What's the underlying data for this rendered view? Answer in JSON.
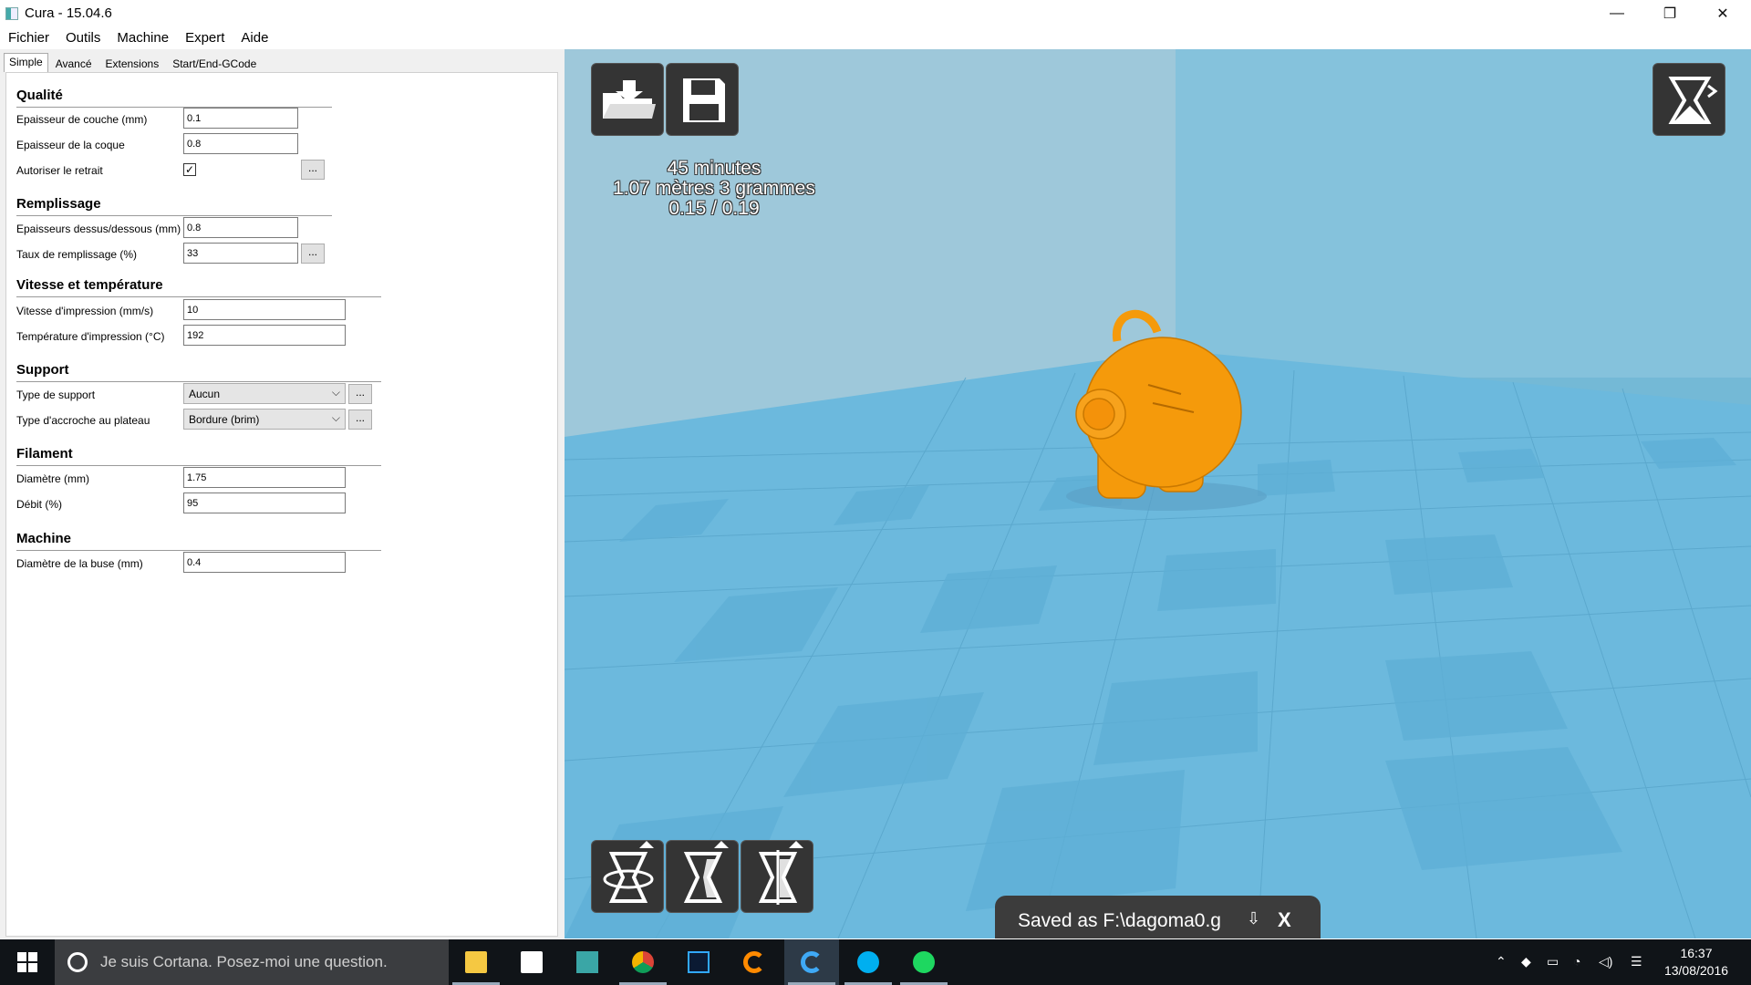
{
  "window": {
    "title": "Cura - 15.04.6",
    "minimize": "—",
    "restore": "❐",
    "close": "✕"
  },
  "menu": [
    "Fichier",
    "Outils",
    "Machine",
    "Expert",
    "Aide"
  ],
  "tabs": [
    "Simple",
    "Avancé",
    "Extensions",
    "Start/End-GCode"
  ],
  "sections": {
    "qualite": "Qualité",
    "remplissage": "Remplissage",
    "vitesse": "Vitesse et température",
    "support": "Support",
    "filament": "Filament",
    "machine": "Machine"
  },
  "fields": {
    "layer_height": {
      "label": "Epaisseur de couche (mm)",
      "value": "0.1"
    },
    "shell": {
      "label": "Epaisseur de la coque",
      "value": "0.8"
    },
    "retraction": {
      "label": "Autoriser le retrait",
      "checked": true,
      "mark": "✓"
    },
    "top_bottom": {
      "label": "Epaisseurs dessus/dessous (mm)",
      "value": "0.8"
    },
    "infill": {
      "label": "Taux de remplissage (%)",
      "value": "33"
    },
    "speed": {
      "label": "Vitesse d'impression (mm/s)",
      "value": "10"
    },
    "temp": {
      "label": "Température d'impression (°C)",
      "value": "192"
    },
    "support_type": {
      "label": "Type de support",
      "value": "Aucun"
    },
    "adhesion": {
      "label": "Type d'accroche au plateau",
      "value": "Bordure (brim)"
    },
    "diameter": {
      "label": "Diamètre (mm)",
      "value": "1.75"
    },
    "flow": {
      "label": "Débit (%)",
      "value": "95"
    },
    "nozzle": {
      "label": "Diamètre de la buse (mm)",
      "value": "0.4"
    }
  },
  "dots": "...",
  "stats": {
    "time": "45 minutes",
    "material": "1.07 mètres 3 grammes",
    "ratio": "0.15 / 0.19"
  },
  "toast": {
    "message": "Saved as F:\\dagoma0.g",
    "download_icon": "⇩",
    "close": "X"
  },
  "taskbar": {
    "cortana": "Je suis Cortana. Posez-moi une question.",
    "time": "16:37",
    "date": "13/08/2016"
  },
  "colors": {
    "model": "#f59a0b",
    "floor": "#6cb9dd",
    "wall": "#9ec8da",
    "toolbar": "#343434"
  }
}
